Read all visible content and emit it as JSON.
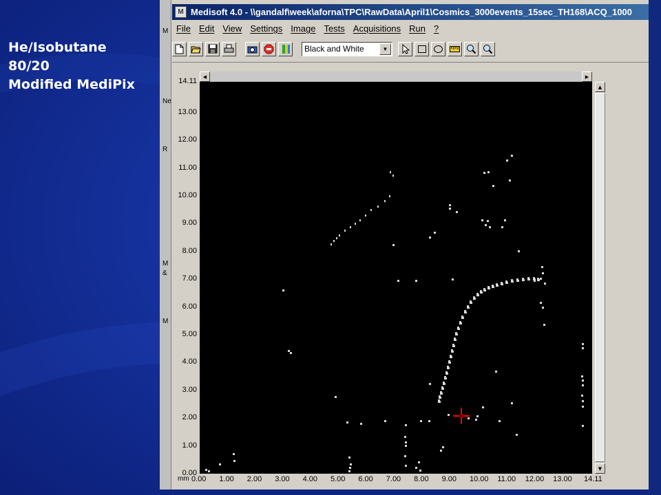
{
  "slide": {
    "caption_lines": [
      "He/Isobutane",
      "80/20",
      "Modified MediPix"
    ]
  },
  "left_strip_letters": [
    "M",
    "Ne",
    "R",
    "M",
    "&",
    "M"
  ],
  "window": {
    "title": "Medisoft 4.0 - \\\\gandalf\\week\\aforna\\TPC\\RawData\\April1\\Cosmics_3000events_15sec_TH168\\ACQ_1000"
  },
  "menu": {
    "items": [
      "File",
      "Edit",
      "View",
      "Settings",
      "Image",
      "Tests",
      "Acquisitions",
      "Run",
      "?"
    ]
  },
  "toolbar": {
    "buttons": [
      "new-file-icon",
      "open-folder-icon",
      "save-icon",
      "print-icon",
      "camera-icon",
      "stop-icon",
      "palette-icon"
    ],
    "color_mode": "Black and White",
    "tools": [
      "pointer-icon",
      "rectangle-icon",
      "ellipse-icon",
      "ruler-icon",
      "zoom-in-icon",
      "zoom-out-icon"
    ]
  },
  "plot": {
    "unit": "mm",
    "y_ticks": [
      "14.11",
      "13.00",
      "12.00",
      "11.00",
      "10.00",
      "9.00",
      "8.00",
      "7.00",
      "6.00",
      "5.00",
      "4.00",
      "3.00",
      "2.00",
      "1.00",
      "0.00"
    ],
    "x_ticks": [
      "0.00",
      "1.00",
      "2.00",
      "3.00",
      "4.00",
      "5.00",
      "6.00",
      "7.00",
      "8.00",
      "9.00",
      "10.00",
      "11.00",
      "12.00",
      "13.00",
      "14.11"
    ],
    "max_mm": 14.11,
    "cursor_color": "#ff0000",
    "hit_color": "#d8d8d8"
  }
}
